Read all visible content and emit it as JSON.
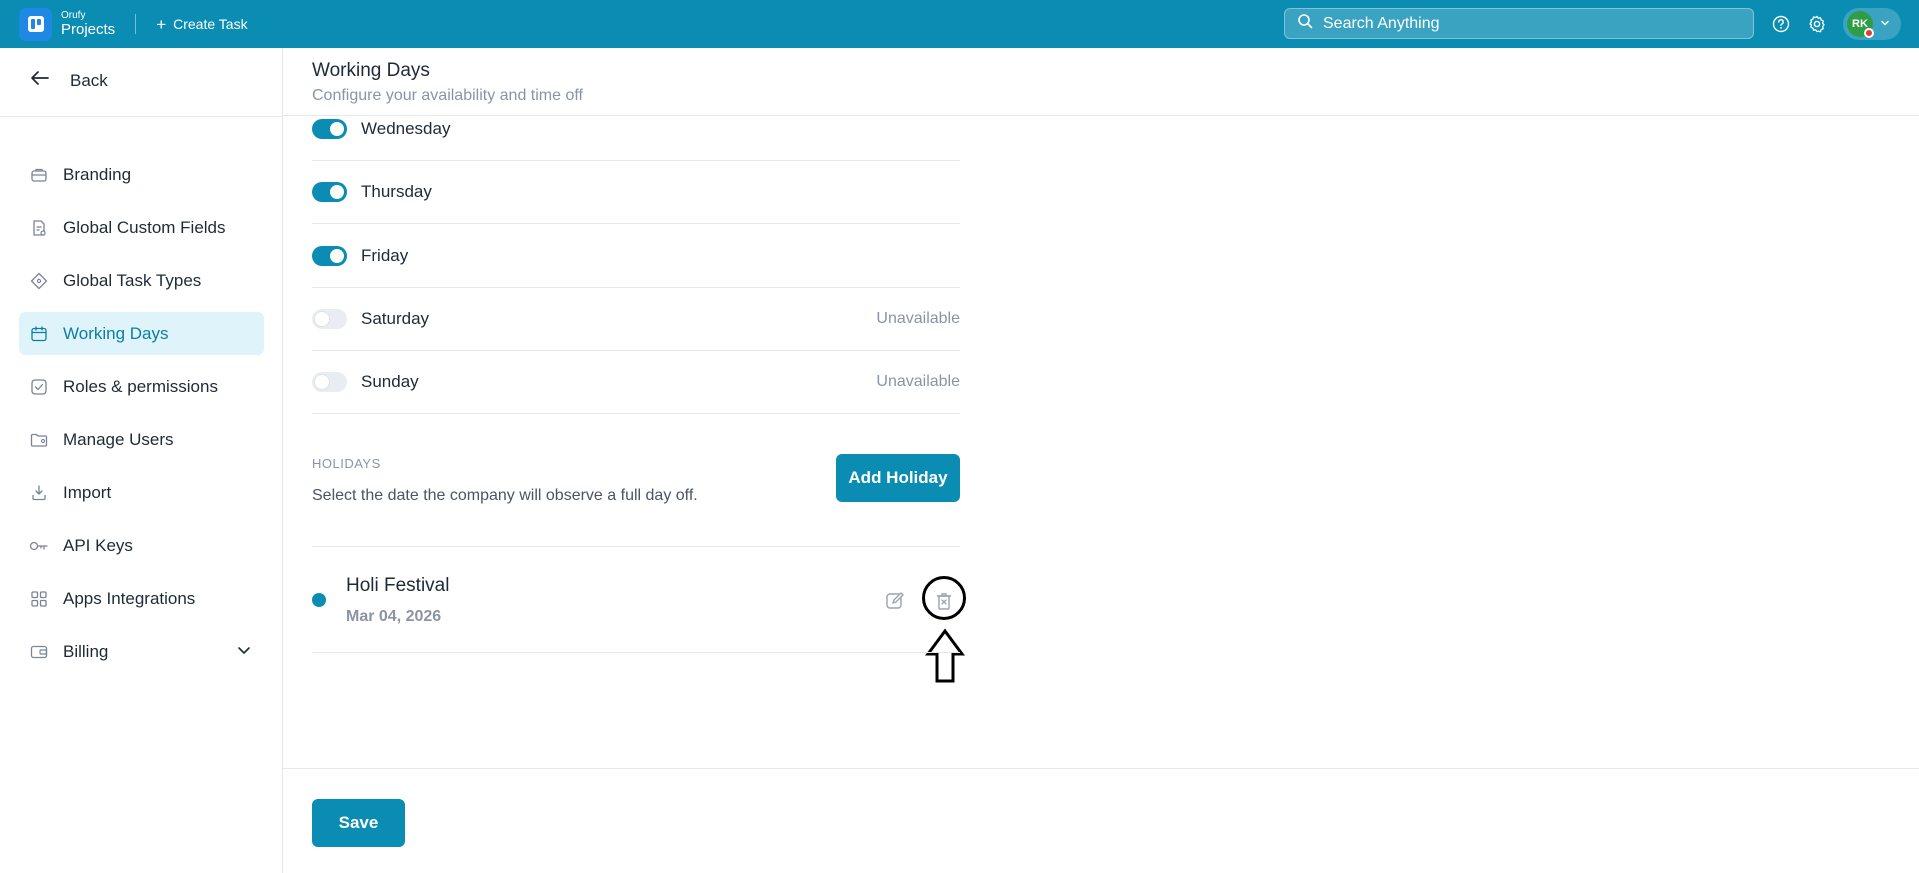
{
  "topbar": {
    "brand_small": "Orufy",
    "brand_big": "Projects",
    "create_task": "Create Task",
    "search_placeholder": "Search Anything",
    "avatar_initials": "RK"
  },
  "sidebar": {
    "back_label": "Back",
    "items": [
      {
        "label": "Branding",
        "icon": "briefcase-icon"
      },
      {
        "label": "Global Custom Fields",
        "icon": "document-icon"
      },
      {
        "label": "Global Task Types",
        "icon": "diamond-icon"
      },
      {
        "label": "Working Days",
        "icon": "calendar-icon",
        "active": true
      },
      {
        "label": "Roles & permissions",
        "icon": "checkbox-icon"
      },
      {
        "label": "Manage Users",
        "icon": "folder-user-icon"
      },
      {
        "label": "Import",
        "icon": "import-icon"
      },
      {
        "label": "API Keys",
        "icon": "key-icon"
      },
      {
        "label": "Apps Integrations",
        "icon": "grid-icon"
      },
      {
        "label": "Billing",
        "icon": "wallet-icon"
      }
    ]
  },
  "header": {
    "title": "Working Days",
    "subtitle": "Configure your availability and time off"
  },
  "days": [
    {
      "name": "Wednesday",
      "enabled": true,
      "status": ""
    },
    {
      "name": "Thursday",
      "enabled": true,
      "status": ""
    },
    {
      "name": "Friday",
      "enabled": true,
      "status": ""
    },
    {
      "name": "Saturday",
      "enabled": false,
      "status": "Unavailable"
    },
    {
      "name": "Sunday",
      "enabled": false,
      "status": "Unavailable"
    }
  ],
  "holidays": {
    "section_label": "HOLIDAYS",
    "description": "Select the date the company will observe a full day off.",
    "add_button": "Add Holiday",
    "items": [
      {
        "name": "Holi Festival",
        "date": "Mar 04, 2026"
      }
    ]
  },
  "footer": {
    "save_label": "Save"
  },
  "colors": {
    "primary": "#0b8db3",
    "active_bg": "#dff3fa",
    "muted_text": "#8a94a6"
  }
}
